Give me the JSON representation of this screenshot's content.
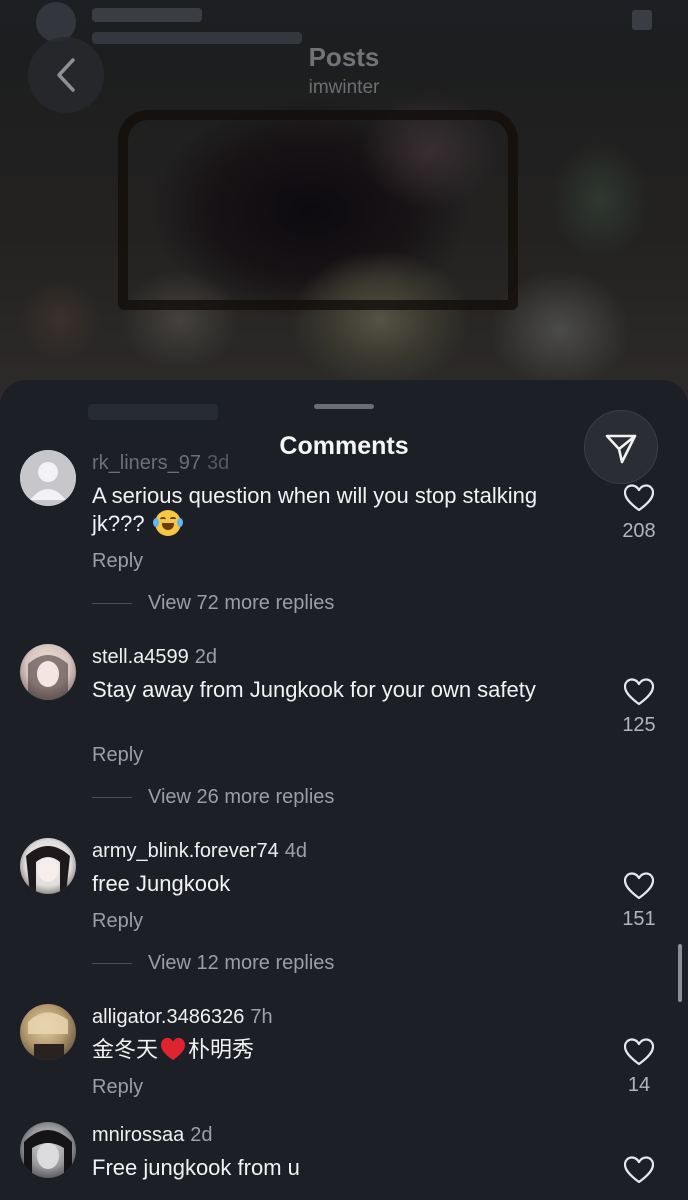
{
  "header": {
    "title": "Posts",
    "username": "imwinter"
  },
  "sheet": {
    "title": "Comments"
  },
  "comments": [
    {
      "username": "rk_liners_97",
      "time": "3d",
      "text": "A serious question when will you stop stalking jk???",
      "emoji": "rolling-on-floor-laughing",
      "likes": "208",
      "reply_label": "Reply",
      "view_more": "View 72 more replies",
      "avatar_color": "#c7c7cb"
    },
    {
      "username": "stell.a4599",
      "time": "2d",
      "text": "Stay away from Jungkook for your own safety",
      "likes": "125",
      "reply_label": "Reply",
      "view_more": "View 26 more replies",
      "avatar_color": "#d8c8c4"
    },
    {
      "username": "army_blink.forever74",
      "time": "4d",
      "text": "free Jungkook",
      "likes": "151",
      "reply_label": "Reply",
      "view_more": "View 12 more replies",
      "avatar_color": "#e8e6e8"
    },
    {
      "username": "alligator.3486326",
      "time": "7h",
      "text_before": "金冬天",
      "text_after": "朴明秀",
      "emoji": "red-heart",
      "likes": "14",
      "reply_label": "Reply",
      "avatar_color": "#b9a890"
    },
    {
      "username": "mnirossaa",
      "time": "2d",
      "text": "Free jungkook from u",
      "avatar_color": "#a8a8ac"
    }
  ],
  "colors": {
    "sheet_bg": "#1c1f26",
    "secondary_text": "#9c9ea4",
    "heart_red": "#e0242f"
  }
}
